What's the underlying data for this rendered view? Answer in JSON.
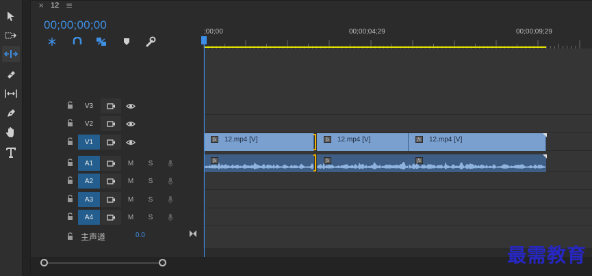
{
  "tab": {
    "close_glyph": "×",
    "title": "12",
    "menu_glyph": "≡"
  },
  "timecode": "00;00;00;00",
  "ruler": {
    "labels": [
      ";00;00",
      "00;00;04;29",
      "00;00;09;29"
    ]
  },
  "tools": [
    "selection-tool",
    "track-select-tool",
    "ripple-edit-tool",
    "razor-tool",
    "slip-tool",
    "pen-tool",
    "hand-tool",
    "type-tool"
  ],
  "timeline_controls": [
    "insert-sequence-icon",
    "snap-icon",
    "linked-selection-icon",
    "add-marker-icon",
    "settings-wrench-icon"
  ],
  "video_tracks": [
    {
      "name": "V3",
      "targeted": false
    },
    {
      "name": "V2",
      "targeted": false
    },
    {
      "name": "V1",
      "targeted": true
    }
  ],
  "audio_tracks": [
    {
      "name": "A1",
      "targeted": true,
      "mute": "M",
      "solo": "S"
    },
    {
      "name": "A2",
      "targeted": true,
      "mute": "M",
      "solo": "S"
    },
    {
      "name": "A3",
      "targeted": true,
      "mute": "M",
      "solo": "S"
    },
    {
      "name": "A4",
      "targeted": true,
      "mute": "M",
      "solo": "S"
    }
  ],
  "master": {
    "label": "主声道",
    "value": "0.0"
  },
  "clips": {
    "video": [
      {
        "label": "12.mp4 [V]",
        "fx": "fx"
      },
      {
        "label": "12.mp4 [V]",
        "fx": "fx"
      },
      {
        "label": "12.mp4 [V]",
        "fx": "fx"
      }
    ],
    "audio": [
      {
        "fx": "fx"
      },
      {
        "fx": "fx"
      },
      {
        "fx": "fx"
      }
    ]
  },
  "watermark": "最需教育",
  "colors": {
    "accent": "#3e8fe3",
    "work_area": "#e6e600",
    "video_clip": "#7aa0d0",
    "audio_clip": "#3e5e86",
    "target": "#235e8e"
  }
}
